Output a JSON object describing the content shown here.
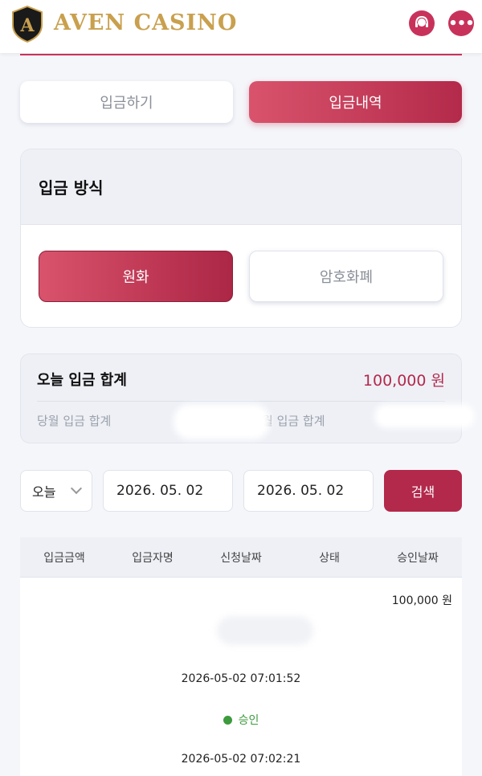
{
  "header": {
    "brand": "AVEN CASINO",
    "logo_letter": "A",
    "icons": {
      "support": "headset-icon",
      "chat": "chat-dots-icon"
    }
  },
  "tabs": [
    {
      "label": "입금하기",
      "active": false
    },
    {
      "label": "입금내역",
      "active": true
    }
  ],
  "method": {
    "title": "입금 방식",
    "options": [
      {
        "label": "원화",
        "active": true
      },
      {
        "label": "암호화폐",
        "active": false
      }
    ]
  },
  "summary": {
    "today_label": "오늘 입금 합계",
    "today_value": "100,000 원",
    "monthly_label": "당월 입금 합계",
    "other_label": "월 입금 합계"
  },
  "filter": {
    "period": "오늘",
    "from": "2026. 05. 02",
    "to": "2026. 05. 02",
    "search": "검색"
  },
  "table": {
    "columns": [
      "입금금액",
      "입금자명",
      "신청날짜",
      "상태",
      "승인날짜"
    ],
    "rows": [
      {
        "amount": "100,000 원",
        "requested": "2026-05-02 07:01:52",
        "status": "승인",
        "approved": "2026-05-02 07:02:21"
      }
    ]
  },
  "colors": {
    "accent": "#c8325a",
    "brand_gold": "#c9a04e",
    "success": "#3d9a3d"
  }
}
